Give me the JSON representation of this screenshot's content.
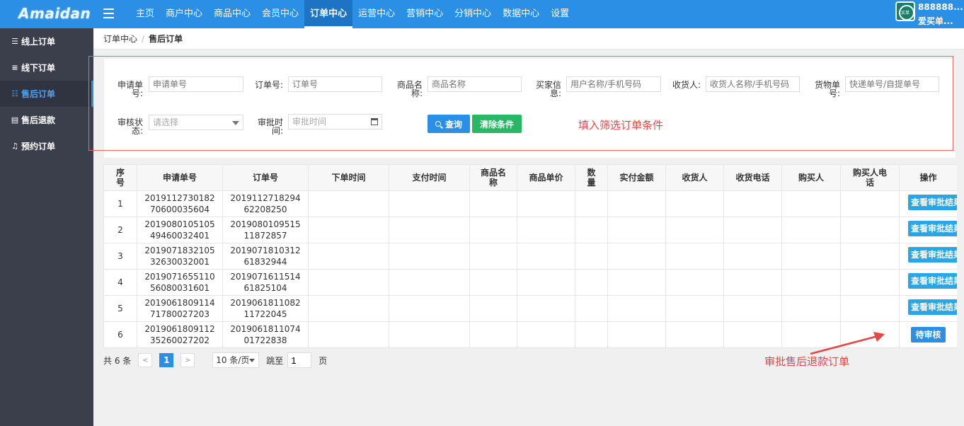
{
  "app": {
    "logo": "Amaidan",
    "user_id": "888888...",
    "user_name": "爱买单...",
    "avatar_text": "买单"
  },
  "top_nav": [
    {
      "label": "主页"
    },
    {
      "label": "商户中心"
    },
    {
      "label": "商品中心"
    },
    {
      "label": "会员中心"
    },
    {
      "label": "订单中心",
      "active": true
    },
    {
      "label": "运营中心"
    },
    {
      "label": "营销中心"
    },
    {
      "label": "分销中心"
    },
    {
      "label": "数据中心"
    },
    {
      "label": "设置"
    }
  ],
  "sidebar": {
    "items": [
      {
        "label": "线上订单",
        "icon": "list-icon"
      },
      {
        "label": "线下订单",
        "icon": "lines-icon"
      },
      {
        "label": "售后订单",
        "icon": "list-icon",
        "active": true
      },
      {
        "label": "售后退款",
        "icon": "receipt-icon"
      },
      {
        "label": "预约订单",
        "icon": "bell-icon"
      }
    ]
  },
  "breadcrumb": {
    "parent": "订单中心",
    "separator": "/",
    "current": "售后订单"
  },
  "filters": {
    "apply_no": {
      "label": "申请单号:",
      "placeholder": "申请单号"
    },
    "order_no": {
      "label": "订单号:",
      "placeholder": "订单号"
    },
    "product_name": {
      "label": "商品名称:",
      "placeholder": "商品名称"
    },
    "buyer_info": {
      "label": "买家信息:",
      "placeholder": "用户名称/手机号码"
    },
    "receiver": {
      "label": "收货人:",
      "placeholder": "收货人名称/手机号码"
    },
    "waybill_no": {
      "label": "货物单号:",
      "placeholder": "快递单号/自提单号"
    },
    "audit_status": {
      "label": "审核状态:",
      "placeholder": "请选择"
    },
    "audit_time": {
      "label": "审批时间:",
      "placeholder": "审批时间"
    },
    "query_label": "查询",
    "clear_label": "清除条件"
  },
  "annotations": {
    "filter_note": "填入筛选订单条件",
    "approve_note": "审批售后退款订单",
    "color": "#e84545"
  },
  "table": {
    "columns": [
      "序号",
      "申请单号",
      "订单号",
      "下单时间",
      "支付时间",
      "商品名称",
      "商品单价",
      "数量",
      "实付金额",
      "收货人",
      "收货电话",
      "购买人",
      "购买人电话",
      "操作"
    ],
    "rows": [
      {
        "index": "1",
        "apply_no": "201911273018270600035604",
        "order_no": "201911271829462208250",
        "action": "查看审批结果"
      },
      {
        "index": "2",
        "apply_no": "201908010510549460032401",
        "order_no": "201908010951511872857",
        "action": "查看审批结果"
      },
      {
        "index": "3",
        "apply_no": "201907183210532630032001",
        "order_no": "201907181031261832944",
        "action": "查看审批结果"
      },
      {
        "index": "4",
        "apply_no": "201907165511056080031601",
        "order_no": "201907161151461825104",
        "action": "查看审批结果"
      },
      {
        "index": "5",
        "apply_no": "201906180911471780027203",
        "order_no": "201906181108211722045",
        "action": "查看审批结果"
      },
      {
        "index": "6",
        "apply_no": "201906180911235260027202",
        "order_no": "201906181107401722838",
        "action": "待审核"
      }
    ]
  },
  "pagination": {
    "total": "共 6 条",
    "prev": "<",
    "current": "1",
    "next": ">",
    "page_size": "10 条/页",
    "goto_label": "跳至",
    "goto_value": "1",
    "page_suffix": "页"
  },
  "colors": {
    "primary": "#2b8fe6",
    "sidebar_bg": "#3a3f4b",
    "success": "#29b765"
  }
}
